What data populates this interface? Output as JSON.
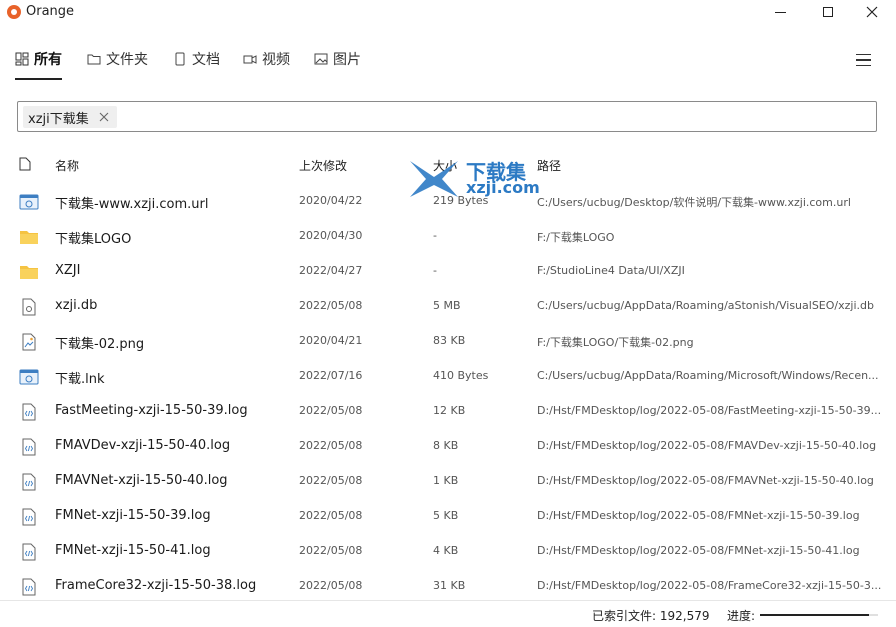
{
  "window": {
    "title": "Orange"
  },
  "tabs": [
    {
      "label": "所有",
      "icon": "grid-icon",
      "active": true
    },
    {
      "label": "文件夹",
      "icon": "folder-icon",
      "active": false
    },
    {
      "label": "文档",
      "icon": "document-icon",
      "active": false
    },
    {
      "label": "视频",
      "icon": "video-icon",
      "active": false
    },
    {
      "label": "图片",
      "icon": "image-icon",
      "active": false
    }
  ],
  "search": {
    "value": "xzji下载集"
  },
  "columns": {
    "name": "名称",
    "modified": "上次修改",
    "size": "大小",
    "path": "路径"
  },
  "watermark": {
    "text": "下载集",
    "sub": "xzji.com"
  },
  "files": [
    {
      "name": "下载集-www.xzji.com.url",
      "modified": "2020/04/22",
      "size": "219 Bytes",
      "path": "C:/Users/ucbug/Desktop/软件说明/下载集-www.xzji.com.url",
      "type": "url"
    },
    {
      "name": "下载集LOGO",
      "modified": "2020/04/30",
      "size": "-",
      "path": "F:/下载集LOGO",
      "type": "folder"
    },
    {
      "name": "XZJI",
      "modified": "2022/04/27",
      "size": "-",
      "path": "F:/StudioLine4 Data/UI/XZJI",
      "type": "folder"
    },
    {
      "name": "xzji.db",
      "modified": "2022/05/08",
      "size": "5 MB",
      "path": "C:/Users/ucbug/AppData/Roaming/aStonish/VisualSEO/xzji.db",
      "type": "db"
    },
    {
      "name": "下载集-02.png",
      "modified": "2020/04/21",
      "size": "83 KB",
      "path": "F:/下载集LOGO/下载集-02.png",
      "type": "image"
    },
    {
      "name": "下载.lnk",
      "modified": "2022/07/16",
      "size": "410 Bytes",
      "path": "C:/Users/ucbug/AppData/Roaming/Microsoft/Windows/Recen...",
      "type": "url"
    },
    {
      "name": "FastMeeting-xzji-15-50-39.log",
      "modified": "2022/05/08",
      "size": "12 KB",
      "path": "D:/Hst/FMDesktop/log/2022-05-08/FastMeeting-xzji-15-50-39....",
      "type": "log"
    },
    {
      "name": "FMAVDev-xzji-15-50-40.log",
      "modified": "2022/05/08",
      "size": "8 KB",
      "path": "D:/Hst/FMDesktop/log/2022-05-08/FMAVDev-xzji-15-50-40.log",
      "type": "log"
    },
    {
      "name": "FMAVNet-xzji-15-50-40.log",
      "modified": "2022/05/08",
      "size": "1 KB",
      "path": "D:/Hst/FMDesktop/log/2022-05-08/FMAVNet-xzji-15-50-40.log",
      "type": "log"
    },
    {
      "name": "FMNet-xzji-15-50-39.log",
      "modified": "2022/05/08",
      "size": "5 KB",
      "path": "D:/Hst/FMDesktop/log/2022-05-08/FMNet-xzji-15-50-39.log",
      "type": "log"
    },
    {
      "name": "FMNet-xzji-15-50-41.log",
      "modified": "2022/05/08",
      "size": "4 KB",
      "path": "D:/Hst/FMDesktop/log/2022-05-08/FMNet-xzji-15-50-41.log",
      "type": "log"
    },
    {
      "name": "FrameCore32-xzji-15-50-38.log",
      "modified": "2022/05/08",
      "size": "31 KB",
      "path": "D:/Hst/FMDesktop/log/2022-05-08/FrameCore32-xzji-15-50-3...",
      "type": "log"
    }
  ],
  "status": {
    "indexed": "已索引文件: 192,579",
    "progress_label": "进度:",
    "progress": 0.92
  }
}
